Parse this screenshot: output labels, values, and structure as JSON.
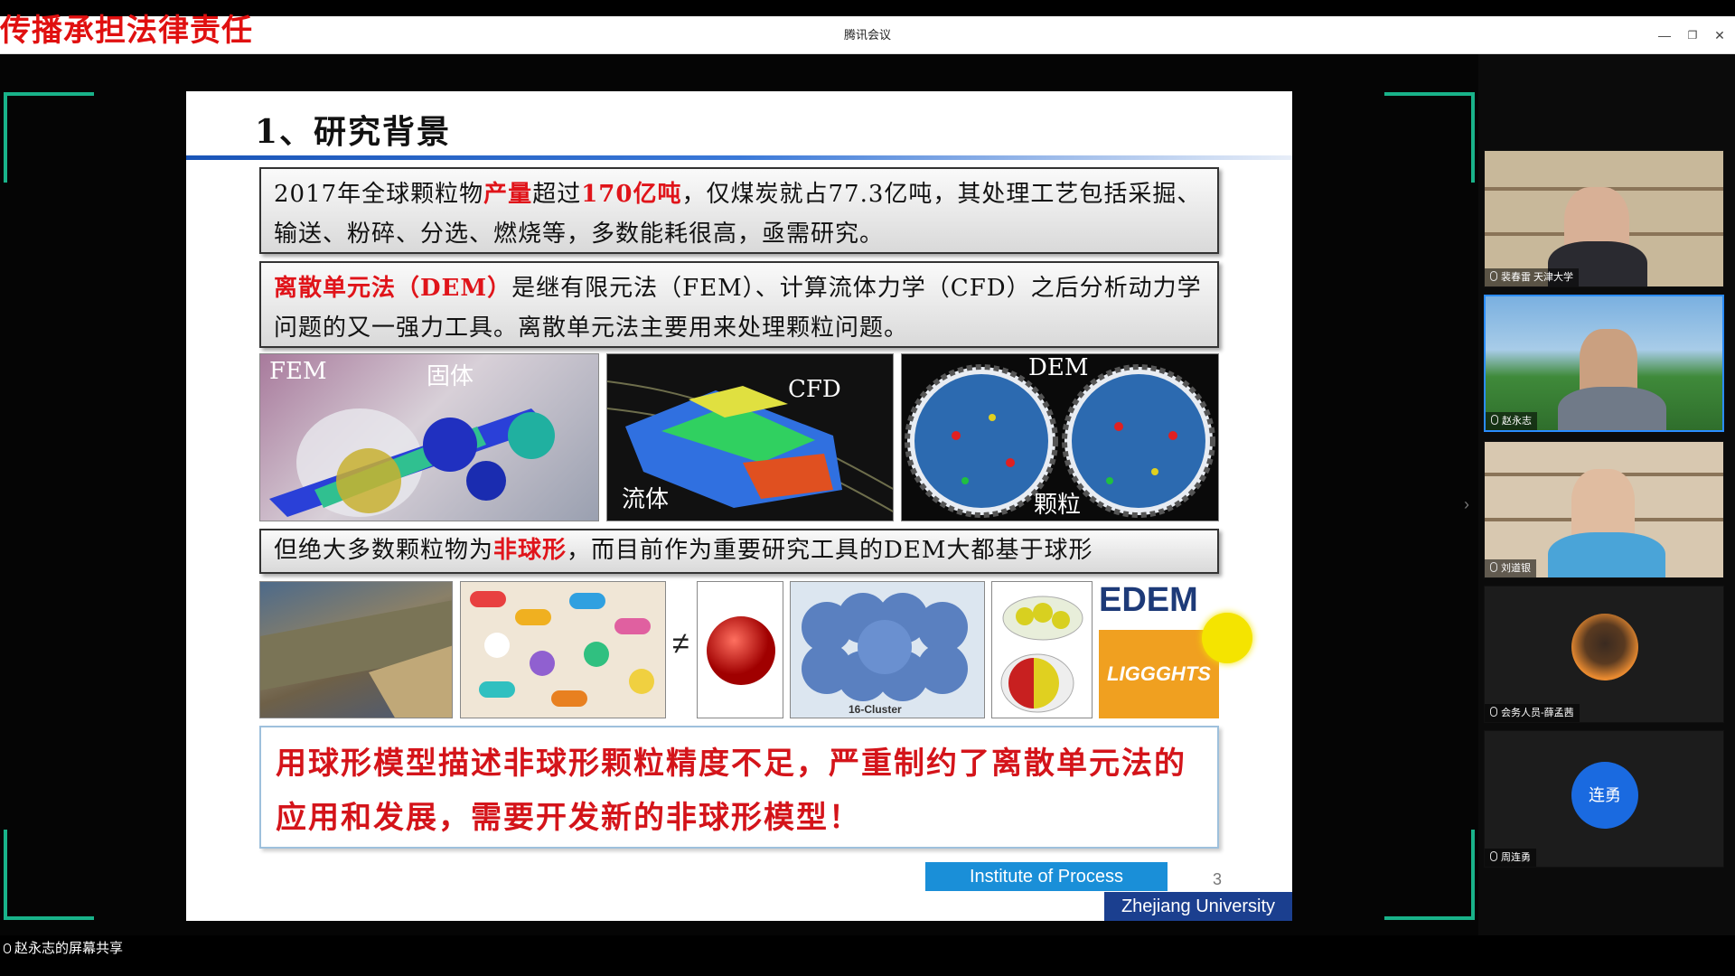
{
  "window": {
    "title": "腾讯会议",
    "overlay_warning": "传播承担法律责任",
    "minimize": "—",
    "restore": "❐",
    "close": "✕"
  },
  "slide": {
    "title": "1、研究背景",
    "box1": {
      "a": "2017年全球颗粒物",
      "b": "产量",
      "c": "超过",
      "d": "170亿吨",
      "e": "，仅煤炭就占77.3亿吨，其处理工艺包括采掘、输送、粉碎、分选、燃烧等，多数能耗很高，亟需研究。"
    },
    "box2": {
      "a": "离散单元法（DEM）",
      "b": "是继有限元法（FEM）、计算流体力学（CFD）之后分析动力学问题的又一强力工具。离散单元法主要用来处理颗粒问题。"
    },
    "images": {
      "fem_label": "FEM",
      "solid_label": "固体",
      "cfd_label": "CFD",
      "fluid_label": "流体",
      "dem_label": "DEM",
      "particle_label": "颗粒"
    },
    "box3": {
      "a": "但绝大多数颗粒物为",
      "b": "非球形",
      "c": "，而目前作为重要研究工具的DEM大都基于球形"
    },
    "not_equal": "≠",
    "cluster_label": "16-Cluster",
    "edem_logo": "EDEM",
    "liggghts_logo": "LIGGGHTS",
    "conclusion": "用球形模型描述非球形颗粒精度不足，严重制约了离散单元法的应用和发展，需要开发新的非球形模型！",
    "institute": "Institute of Process Equipment",
    "page_number": "3",
    "university": "Zhejiang University"
  },
  "participants": [
    {
      "name": "裴春雷 天津大学"
    },
    {
      "name": "赵永志"
    },
    {
      "name": "刘道银"
    },
    {
      "name": "会务人员-薛孟茜"
    },
    {
      "name": "周连勇",
      "avatar_text": "连勇"
    }
  ],
  "status": {
    "sharer": "赵永志的屏幕共享"
  },
  "colors": {
    "accent_red": "#e0141a",
    "frame_green": "#19b38a",
    "institute_blue": "#1a8fd8",
    "zju_blue": "#1b3f8f"
  }
}
